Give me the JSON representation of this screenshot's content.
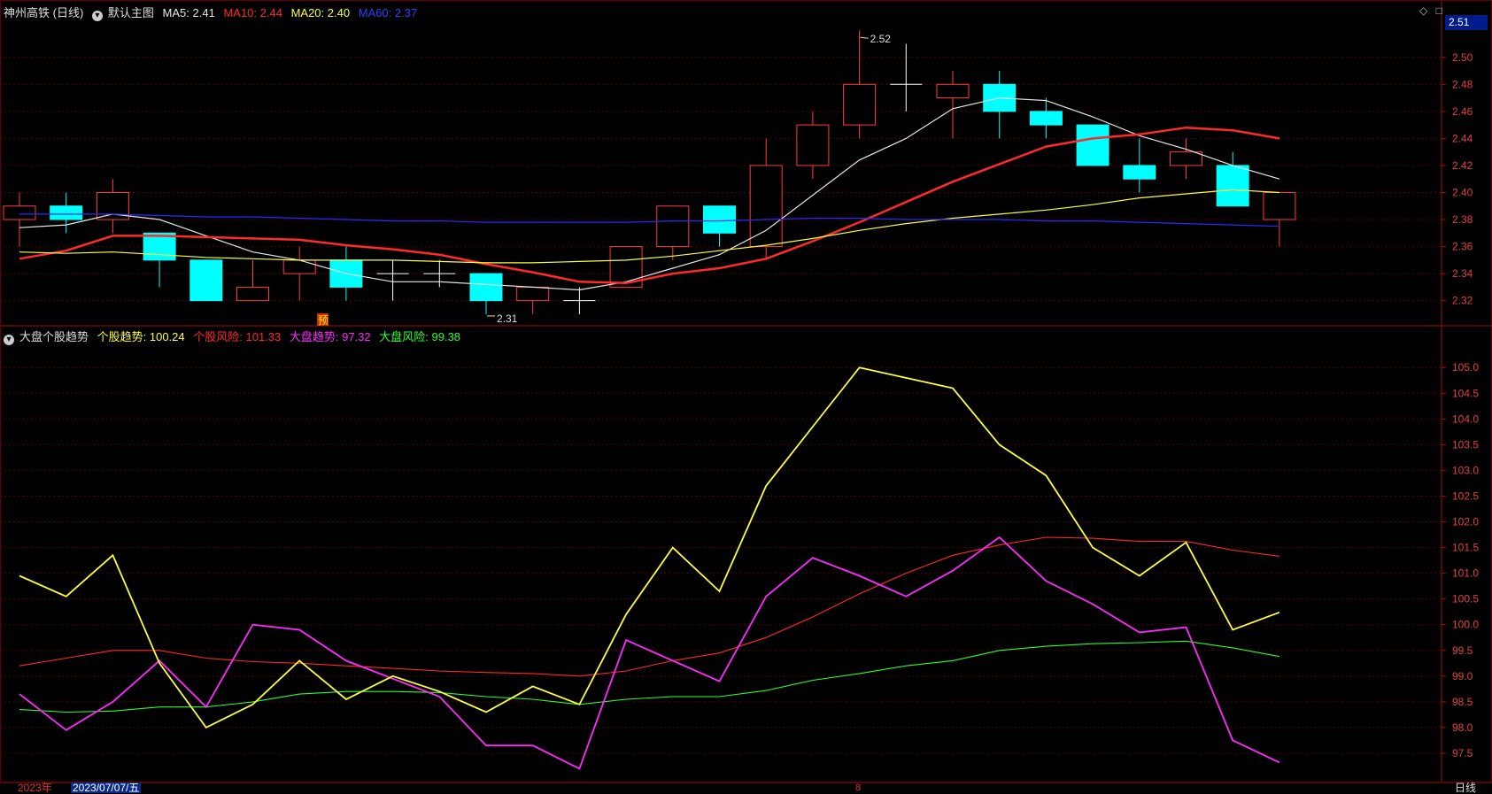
{
  "header": {
    "stock_title": "神州高铁 (日线)",
    "main_chart_label": "默认主图",
    "ma_items": [
      {
        "label": "MA5: 2.41",
        "color": "#e6e6e6"
      },
      {
        "label": "MA10: 2.44",
        "color": "#ff2a2a"
      },
      {
        "label": "MA20: 2.40",
        "color": "#ffff3a"
      },
      {
        "label": "MA60: 2.37",
        "color": "#2a2aff"
      }
    ]
  },
  "indicator_header": {
    "name": "大盘个股趋势",
    "items": [
      {
        "label": "个股趋势: 100.24",
        "color": "#ffff3a"
      },
      {
        "label": "个股风险: 101.33",
        "color": "#ff2a2a"
      },
      {
        "label": "大盘趋势: 97.32",
        "color": "#ff2aff"
      },
      {
        "label": "大盘风险: 99.38",
        "color": "#2aff2a"
      }
    ]
  },
  "top_right_icons": [
    "diamond-icon",
    "square-icon"
  ],
  "current_price_tag": "2.51",
  "footer": {
    "year_label": "2023年",
    "cursor_date": "2023/07/07/五",
    "month_marker": "8",
    "period_label": "日线"
  },
  "colors": {
    "up": "#ff3c3c",
    "down": "#00ffff",
    "grid": "#5a0000",
    "axis_text": "#e04040",
    "ma5": "#e6e6e6",
    "ma10": "#ff2a2a",
    "ma20": "#ffff3a",
    "ma60": "#2a2aff",
    "trend_stock": "#ffff3a",
    "risk_stock": "#ff2a2a",
    "trend_market": "#ff2aff",
    "risk_market": "#2aff2a"
  },
  "chart_data": [
    {
      "type": "candlestick",
      "title": "神州高铁 (日线)",
      "y_ticks": [
        "2.32",
        "2.34",
        "2.36",
        "2.38",
        "2.40",
        "2.42",
        "2.44",
        "2.46",
        "2.48",
        "2.50"
      ],
      "ylim": [
        2.308,
        2.528
      ],
      "candles": [
        {
          "o": 2.38,
          "h": 2.4,
          "l": 2.36,
          "c": 2.39
        },
        {
          "o": 2.39,
          "h": 2.4,
          "l": 2.37,
          "c": 2.38
        },
        {
          "o": 2.38,
          "h": 2.41,
          "l": 2.37,
          "c": 2.4
        },
        {
          "o": 2.37,
          "h": 2.37,
          "l": 2.33,
          "c": 2.35
        },
        {
          "o": 2.35,
          "h": 2.35,
          "l": 2.32,
          "c": 2.32
        },
        {
          "o": 2.32,
          "h": 2.35,
          "l": 2.32,
          "c": 2.33
        },
        {
          "o": 2.34,
          "h": 2.36,
          "l": 2.32,
          "c": 2.35
        },
        {
          "o": 2.35,
          "h": 2.36,
          "l": 2.32,
          "c": 2.33
        },
        {
          "o": 2.34,
          "h": 2.35,
          "l": 2.32,
          "c": 2.34
        },
        {
          "o": 2.34,
          "h": 2.35,
          "l": 2.33,
          "c": 2.34
        },
        {
          "o": 2.34,
          "h": 2.34,
          "l": 2.31,
          "c": 2.32
        },
        {
          "o": 2.32,
          "h": 2.33,
          "l": 2.31,
          "c": 2.33
        },
        {
          "o": 2.32,
          "h": 2.33,
          "l": 2.31,
          "c": 2.32
        },
        {
          "o": 2.33,
          "h": 2.36,
          "l": 2.33,
          "c": 2.36
        },
        {
          "o": 2.36,
          "h": 2.39,
          "l": 2.35,
          "c": 2.39
        },
        {
          "o": 2.39,
          "h": 2.39,
          "l": 2.36,
          "c": 2.37
        },
        {
          "o": 2.36,
          "h": 2.44,
          "l": 2.35,
          "c": 2.42
        },
        {
          "o": 2.42,
          "h": 2.46,
          "l": 2.41,
          "c": 2.45
        },
        {
          "o": 2.45,
          "h": 2.52,
          "l": 2.44,
          "c": 2.48
        },
        {
          "o": 2.48,
          "h": 2.51,
          "l": 2.46,
          "c": 2.48
        },
        {
          "o": 2.47,
          "h": 2.49,
          "l": 2.44,
          "c": 2.48
        },
        {
          "o": 2.48,
          "h": 2.49,
          "l": 2.44,
          "c": 2.46
        },
        {
          "o": 2.46,
          "h": 2.47,
          "l": 2.44,
          "c": 2.45
        },
        {
          "o": 2.45,
          "h": 2.45,
          "l": 2.42,
          "c": 2.42
        },
        {
          "o": 2.42,
          "h": 2.44,
          "l": 2.4,
          "c": 2.41
        },
        {
          "o": 2.42,
          "h": 2.44,
          "l": 2.41,
          "c": 2.43
        },
        {
          "o": 2.42,
          "h": 2.43,
          "l": 2.39,
          "c": 2.39
        },
        {
          "o": 2.38,
          "h": 2.4,
          "l": 2.36,
          "c": 2.4
        }
      ],
      "series": [
        {
          "name": "MA5",
          "key": "ma5",
          "values": [
            2.374,
            2.376,
            2.384,
            2.38,
            2.368,
            2.356,
            2.35,
            2.34,
            2.334,
            2.334,
            2.332,
            2.33,
            2.328,
            2.334,
            2.344,
            2.354,
            2.372,
            2.398,
            2.424,
            2.44,
            2.462,
            2.47,
            2.468,
            2.456,
            2.442,
            2.432,
            2.42,
            2.41
          ]
        },
        {
          "name": "MA10",
          "key": "ma10",
          "values": [
            2.351,
            2.357,
            2.368,
            2.368,
            2.367,
            2.366,
            2.365,
            2.361,
            2.358,
            2.354,
            2.347,
            2.341,
            2.334,
            2.333,
            2.34,
            2.344,
            2.351,
            2.364,
            2.378,
            2.393,
            2.408,
            2.421,
            2.434,
            2.44,
            2.443,
            2.448,
            2.446,
            2.44
          ]
        },
        {
          "name": "MA20",
          "key": "ma20",
          "values": [
            2.356,
            2.355,
            2.356,
            2.354,
            2.352,
            2.351,
            2.35,
            2.35,
            2.35,
            2.349,
            2.348,
            2.348,
            2.349,
            2.35,
            2.353,
            2.357,
            2.361,
            2.366,
            2.372,
            2.377,
            2.381,
            2.384,
            2.387,
            2.391,
            2.396,
            2.399,
            2.402,
            2.4
          ]
        },
        {
          "name": "MA60",
          "key": "ma60",
          "values": [
            2.384,
            2.384,
            2.384,
            2.383,
            2.382,
            2.382,
            2.381,
            2.38,
            2.379,
            2.379,
            2.378,
            2.378,
            2.378,
            2.378,
            2.379,
            2.379,
            2.38,
            2.381,
            2.381,
            2.38,
            2.38,
            2.38,
            2.379,
            2.379,
            2.378,
            2.377,
            2.376,
            2.375
          ]
        }
      ],
      "annotations": [
        {
          "index": 18,
          "value": 2.52,
          "text": "2.52"
        },
        {
          "index": 10,
          "value": 2.31,
          "text": "2.31"
        }
      ],
      "marker": {
        "index": 7,
        "text": "预"
      }
    },
    {
      "type": "line",
      "title": "大盘个股趋势",
      "y_ticks": [
        "97.5",
        "98.0",
        "98.5",
        "99.0",
        "99.5",
        "100.0",
        "100.5",
        "101.0",
        "101.5",
        "102.0",
        "102.5",
        "103.0",
        "103.5",
        "104.0",
        "104.5",
        "105.0"
      ],
      "ylim": [
        97.0,
        105.4
      ],
      "series": [
        {
          "name": "个股趋势",
          "key": "trend_stock",
          "values": [
            100.95,
            100.55,
            101.35,
            99.25,
            98.0,
            98.45,
            99.3,
            98.55,
            99.0,
            98.7,
            98.3,
            98.8,
            98.45,
            100.2,
            101.5,
            100.65,
            102.7,
            103.85,
            105.0,
            104.8,
            104.6,
            103.5,
            102.9,
            101.5,
            100.95,
            101.6,
            99.9,
            100.24
          ]
        },
        {
          "name": "个股风险",
          "key": "risk_stock",
          "values": [
            99.2,
            99.35,
            99.5,
            99.5,
            99.35,
            99.28,
            99.25,
            99.2,
            99.15,
            99.1,
            99.07,
            99.05,
            99.0,
            99.1,
            99.3,
            99.45,
            99.75,
            100.15,
            100.6,
            101.0,
            101.35,
            101.55,
            101.7,
            101.68,
            101.62,
            101.62,
            101.45,
            101.33
          ]
        },
        {
          "name": "大盘趋势",
          "key": "trend_market",
          "values": [
            98.65,
            97.95,
            98.5,
            99.3,
            98.4,
            100.0,
            99.9,
            99.3,
            98.95,
            98.6,
            97.65,
            97.65,
            97.2,
            99.7,
            99.3,
            98.9,
            100.55,
            101.3,
            100.95,
            100.55,
            101.05,
            101.7,
            100.85,
            100.4,
            99.85,
            99.95,
            97.75,
            97.32
          ]
        },
        {
          "name": "大盘风险",
          "key": "risk_market",
          "values": [
            98.35,
            98.3,
            98.32,
            98.4,
            98.4,
            98.5,
            98.65,
            98.7,
            98.7,
            98.68,
            98.6,
            98.55,
            98.45,
            98.55,
            98.6,
            98.6,
            98.72,
            98.92,
            99.05,
            99.2,
            99.3,
            99.5,
            99.58,
            99.63,
            99.65,
            99.68,
            99.55,
            99.38
          ]
        }
      ]
    }
  ]
}
